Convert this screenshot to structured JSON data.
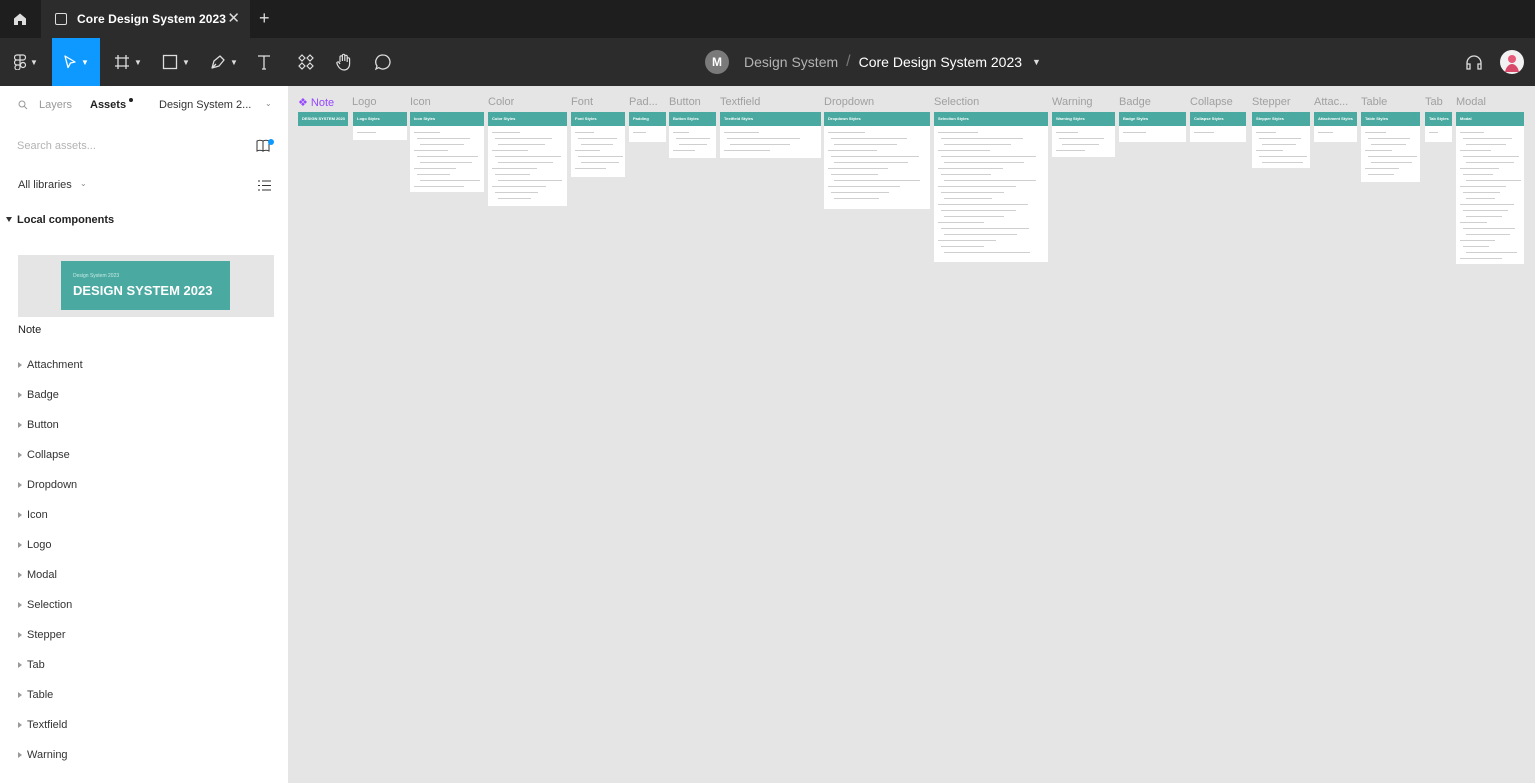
{
  "tabbar": {
    "tab_title": "Core Design System 2023",
    "close_glyph": "✕",
    "new_tab_glyph": "+"
  },
  "toolbar": {
    "team_initial": "M",
    "team_name": "Design System",
    "separator": "/",
    "file_name": "Core Design System 2023"
  },
  "sidebar": {
    "tabs": {
      "layers": "Layers",
      "assets": "Assets",
      "library": "Design System 2..."
    },
    "search_placeholder": "Search assets...",
    "libraries_filter": "All libraries",
    "section_title": "Local components",
    "thumb_subtitle": "Design System 2023",
    "thumb_title": "DESIGN SYSTEM 2023",
    "thumb_label": "Note",
    "components": [
      "Attachment",
      "Badge",
      "Button",
      "Collapse",
      "Dropdown",
      "Icon",
      "Logo",
      "Modal",
      "Selection",
      "Stepper",
      "Tab",
      "Table",
      "Textfield",
      "Warning"
    ]
  },
  "canvas": {
    "frames": [
      {
        "label": "❖ Note",
        "header": "DESIGN SYSTEM 2023"
      },
      {
        "label": "Logo",
        "header": "Logo Styles"
      },
      {
        "label": "Icon",
        "header": "Icon Styles"
      },
      {
        "label": "Color",
        "header": "Color Styles"
      },
      {
        "label": "Font",
        "header": "Font Styles"
      },
      {
        "label": "Pad...",
        "header": "Padding"
      },
      {
        "label": "Button",
        "header": "Button Styles"
      },
      {
        "label": "Textfield",
        "header": "Textfield Styles"
      },
      {
        "label": "Dropdown",
        "header": "Dropdown Styles"
      },
      {
        "label": "Selection",
        "header": "Selection Styles"
      },
      {
        "label": "Warning",
        "header": "Warning Styles"
      },
      {
        "label": "Badge",
        "header": "Badge Styles"
      },
      {
        "label": "Collapse",
        "header": "Collapse Styles"
      },
      {
        "label": "Stepper",
        "header": "Stepper Styles"
      },
      {
        "label": "Attac...",
        "header": "Attachment Styles"
      },
      {
        "label": "Table",
        "header": "Table Styles"
      },
      {
        "label": "Tab",
        "header": "Tab Styles"
      },
      {
        "label": "Modal",
        "header": "Modal"
      }
    ]
  },
  "colors": {
    "accent": "#0d99ff",
    "frame_header": "#4aa9a0",
    "note_purple": "#9747ff"
  }
}
